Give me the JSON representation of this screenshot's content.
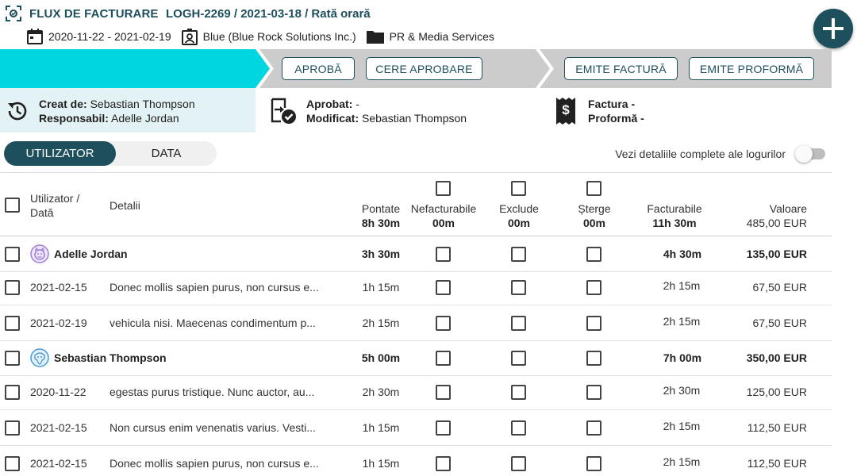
{
  "header": {
    "title": "FLUX DE FACTURARE",
    "reference": "LOGH-2269 / 2021-03-18 / Rată orară",
    "period": "2020-11-22 - 2021-02-19",
    "client": "Blue (Blue Rock Solutions Inc.)",
    "project": "PR & Media Services"
  },
  "workflow": {
    "approve_label": "APROBĂ",
    "request_approval_label": "CERE APROBARE",
    "issue_invoice_label": "EMITE FACTURĂ",
    "issue_proforma_label": "EMITE PROFORMĂ",
    "accent_active": "#00d6e0",
    "accent_inactive": "#cccccc"
  },
  "info": {
    "created_label": "Creat de:",
    "created_value": "Sebastian Thompson",
    "responsible_label": "Responsabil:",
    "responsible_value": "Adelle Jordan",
    "approved_label": "Aprobat:",
    "approved_value": "-",
    "modified_label": "Modificat:",
    "modified_value": "Sebastian Thompson",
    "invoice_label": "Factura",
    "invoice_value": "-",
    "proforma_label": "Proformă",
    "proforma_value": "-"
  },
  "view_toggle": {
    "user_label": "UTILIZATOR",
    "date_label": "DATA",
    "selected": "UTILIZATOR"
  },
  "details_switch": {
    "label": "Vezi detaliile complete ale logurilor",
    "on": false
  },
  "table": {
    "headers": {
      "user_date": "Utilizator / Dată",
      "details": "Detalii",
      "logged": "Pontate",
      "non_billable": "Nefacturabile",
      "exclude": "Exclude",
      "delete": "Șterge",
      "billable": "Facturabile",
      "value": "Valoare"
    },
    "totals": {
      "logged": "8h 30m",
      "non_billable": "00m",
      "exclude": "00m",
      "delete": "00m",
      "billable": "11h 30m",
      "value": "485,00 EUR"
    },
    "groups": [
      {
        "user": "Adelle Jordan",
        "logged": "3h 30m",
        "billable": "4h 30m",
        "value": "135,00 EUR",
        "entries": [
          {
            "date": "2021-02-15",
            "details": "Donec mollis sapien purus, non cursus e...",
            "logged": "1h 15m",
            "billable": "2h 15m",
            "value": "67,50 EUR"
          },
          {
            "date": "2021-02-19",
            "details": "vehicula nisi. Maecenas condimentum p...",
            "logged": "2h 15m",
            "billable": "2h 15m",
            "value": "67,50 EUR"
          }
        ]
      },
      {
        "user": "Sebastian Thompson",
        "logged": "5h 00m",
        "billable": "7h 00m",
        "value": "350,00 EUR",
        "entries": [
          {
            "date": "2020-11-22",
            "details": "egestas purus tristique. Nunc auctor, au...",
            "logged": "2h 30m",
            "billable": "2h 30m",
            "value": "125,00 EUR"
          },
          {
            "date": "2021-02-15",
            "details": "Non cursus enim venenatis varius. Vesti...",
            "logged": "1h 15m",
            "billable": "2h 15m",
            "value": "112,50 EUR"
          },
          {
            "date": "2021-02-15",
            "details": "Donec mollis sapien purus, non cursus e...",
            "logged": "1h 15m",
            "billable": "2h 15m",
            "value": "112,50 EUR"
          }
        ]
      }
    ]
  }
}
